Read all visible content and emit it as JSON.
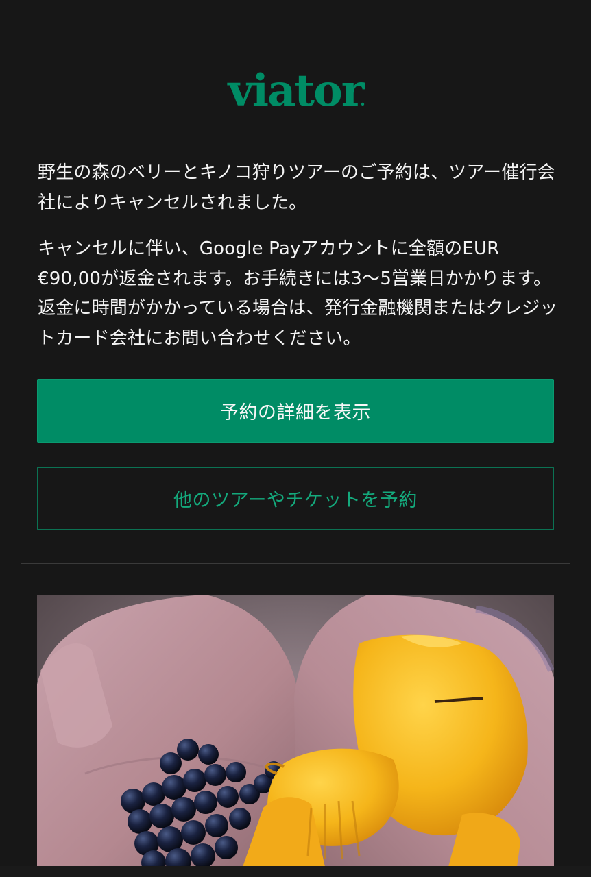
{
  "brand": {
    "logo_text": "viator",
    "color": "#008c65"
  },
  "message": {
    "paragraph_1": "野生の森のベリーとキノコ狩りツアーのご予約は、ツアー催行会社によりキャンセルされました。",
    "paragraph_2": "キャンセルに伴い、Google Payアカウントに全額のEUR €90,00が返金されます。お手続きには3〜5営業日かかります。 返金に時間がかかっている場合は、発行金融機関またはクレジットカード会社にお問い合わせください。"
  },
  "actions": {
    "primary_label": "予約の詳細を表示",
    "secondary_label": "他のツアーやチケットを予約"
  },
  "colors": {
    "background": "#171717",
    "primary_button": "#008c65",
    "secondary_text": "#14a97c"
  }
}
